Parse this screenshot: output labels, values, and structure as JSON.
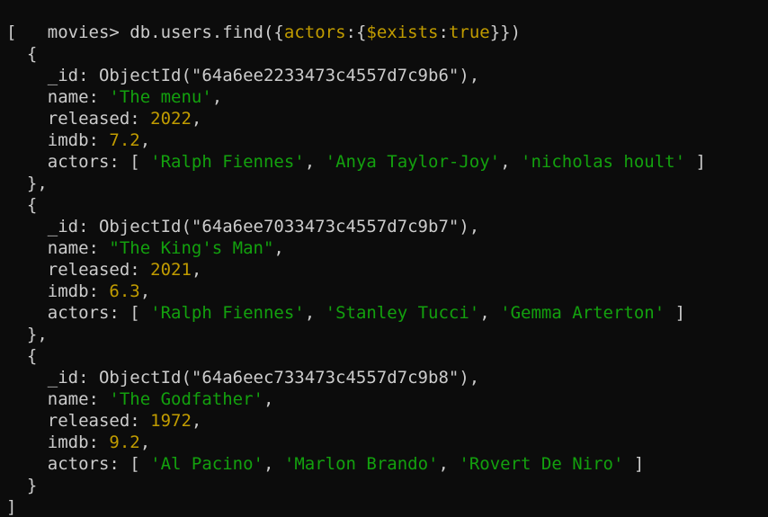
{
  "colors": {
    "background": "#0c0c0c",
    "text": "#cccccc",
    "number_and_key": "#c19c00",
    "string": "#13a10e"
  },
  "command": {
    "prompt": "movies> ",
    "call": "db.users.find({",
    "field": "actors",
    "colon1": ":{",
    "operator": "$exists",
    "colon2": ":",
    "value": "true",
    "close": "}})"
  },
  "punct": {
    "array_open": "[",
    "array_close": "]",
    "doc_open": "  {",
    "doc_close": "  },",
    "doc_close_last": "  }"
  },
  "keys": {
    "id": "    _id: ",
    "name": "    name: ",
    "released": "    released: ",
    "imdb": "    imdb: ",
    "actors": "    actors: [ "
  },
  "results": [
    {
      "id": "ObjectId(\"64a6ee2233473c4557d7c9b6\"),",
      "name": "'The menu'",
      "released": "2022",
      "imdb": "7.2",
      "actors": [
        "'Ralph Fiennes'",
        "'Anya Taylor-Joy'",
        "'nicholas hoult'"
      ]
    },
    {
      "id": "ObjectId(\"64a6ee7033473c4557d7c9b7\"),",
      "name": "\"The King's Man\"",
      "released": "2021",
      "imdb": "6.3",
      "actors": [
        "'Ralph Fiennes'",
        "'Stanley Tucci'",
        "'Gemma Arterton'"
      ]
    },
    {
      "id": "ObjectId(\"64a6eec733473c4557d7c9b8\"),",
      "name": "'The Godfather'",
      "released": "1972",
      "imdb": "9.2",
      "actors": [
        "'Al Pacino'",
        "'Marlon Brando'",
        "'Rovert De Niro'"
      ]
    }
  ],
  "sep": {
    "comma": ",",
    "list_sep": ", ",
    "list_end": " ]"
  }
}
